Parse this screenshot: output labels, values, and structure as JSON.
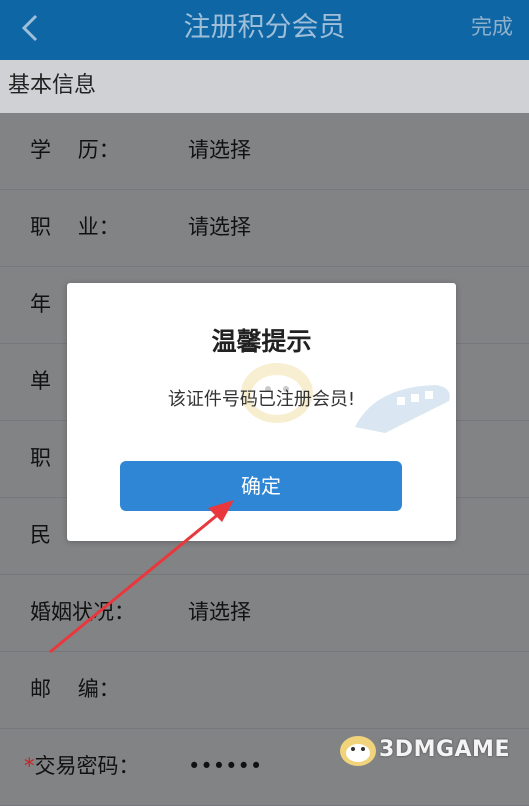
{
  "header": {
    "title": "注册积分会员",
    "done_label": "完成",
    "back_icon": "chevron-left-icon"
  },
  "section": {
    "title": "基本信息"
  },
  "form": {
    "rows": [
      {
        "label": "学    历：",
        "value": "请选择"
      },
      {
        "label": "职    业：",
        "value": "请选择"
      },
      {
        "label": "年",
        "value": ""
      },
      {
        "label": "单",
        "value": ""
      },
      {
        "label": "职",
        "value": ""
      },
      {
        "label": "民",
        "value": ""
      },
      {
        "label": "婚姻状况：",
        "value": "请选择"
      },
      {
        "label": "邮    编：",
        "value": ""
      },
      {
        "label": "交易密码：",
        "value": "••••••",
        "required_mark": "*"
      }
    ]
  },
  "dialog": {
    "title": "温馨提示",
    "message": "该证件号码已注册会员!",
    "confirm_label": "确定"
  },
  "watermark": {
    "text": "3DMGAME"
  },
  "colors": {
    "header_bg": "#0e66a5",
    "button_bg": "#2f86d4",
    "annotation_arrow": "#e8383d"
  }
}
